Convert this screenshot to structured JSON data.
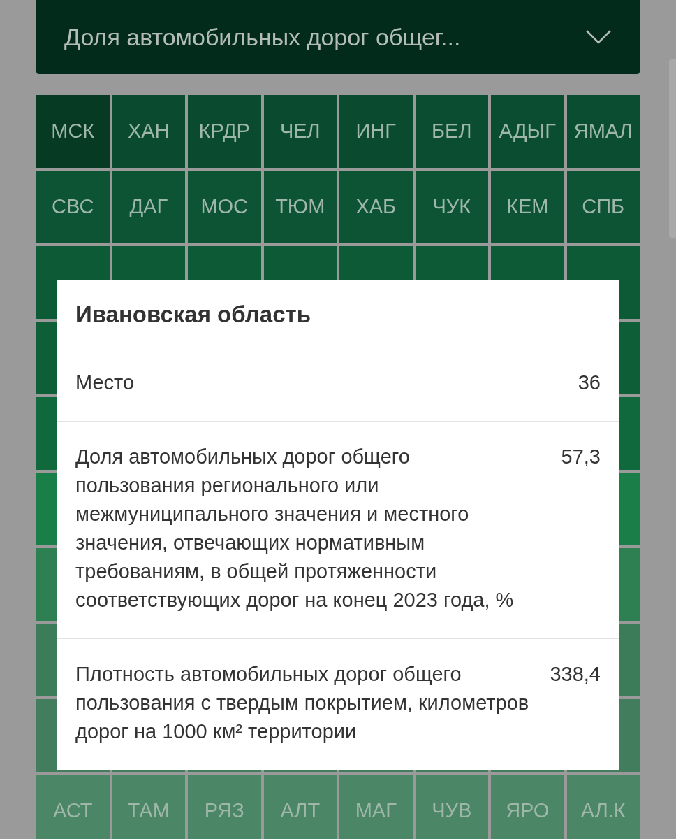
{
  "indicator_select": {
    "value": "Доля автомобильных дорог общег..."
  },
  "grid_rows": [
    {
      "tiles": [
        {
          "label": "МСК",
          "color": "#073a23"
        },
        {
          "label": "ХАН",
          "color": "#0a4a2e"
        },
        {
          "label": "КРДР",
          "color": "#0a4a2e"
        },
        {
          "label": "ЧЕЛ",
          "color": "#0a4a2e"
        },
        {
          "label": "ИНГ",
          "color": "#0a4a2e"
        },
        {
          "label": "БЕЛ",
          "color": "#0b4d30"
        },
        {
          "label": "АДЫГ",
          "color": "#0b4d30"
        },
        {
          "label": "ЯМАЛ",
          "color": "#0b4d30"
        }
      ]
    },
    {
      "tiles": [
        {
          "label": "СВС",
          "color": "#0c5433"
        },
        {
          "label": "ДАГ",
          "color": "#0c5433"
        },
        {
          "label": "МОС",
          "color": "#0c5433"
        },
        {
          "label": "ТЮМ",
          "color": "#0c5433"
        },
        {
          "label": "ХАБ",
          "color": "#0c5433"
        },
        {
          "label": "ЧУК",
          "color": "#0c5433"
        },
        {
          "label": "КЕМ",
          "color": "#0c5433"
        },
        {
          "label": "СПБ",
          "color": "#0c5433"
        }
      ]
    },
    {
      "color": "#0d5a36"
    },
    {
      "color": "#0e5e38"
    },
    {
      "color": "#10693c"
    },
    {
      "color": "#1a7e48"
    },
    {
      "color": "#2e8053"
    },
    {
      "color": "#3c7c59"
    },
    {
      "color": "#427e5d"
    },
    {
      "tiles": [
        {
          "label": "АСТ",
          "color": "#4b8666"
        },
        {
          "label": "ТАМ",
          "color": "#4b8666"
        },
        {
          "label": "РЯЗ",
          "color": "#4b8666"
        },
        {
          "label": "АЛТ",
          "color": "#4b8666"
        },
        {
          "label": "МАГ",
          "color": "#4b8666"
        },
        {
          "label": "ЧУВ",
          "color": "#4b8666"
        },
        {
          "label": "ЯРО",
          "color": "#4b8666"
        },
        {
          "label": "АЛ.К",
          "color": "#4b8666"
        }
      ]
    }
  ],
  "popup": {
    "title": "Ивановская область",
    "rows": [
      {
        "label": "Место",
        "value": "36"
      },
      {
        "label": "Доля автомобильных дорог общего пользования регионального или межмуниципального значения и местного значения, отвечающих нормативным требованиям, в общей протяженности соответствующих дорог на конец 2023 года, %",
        "value": "57,3"
      },
      {
        "label": "Плотность автомобильных дорог общего пользования с твердым покрытием, километров дорог на 1000 км² территории",
        "value": "338,4"
      }
    ]
  }
}
